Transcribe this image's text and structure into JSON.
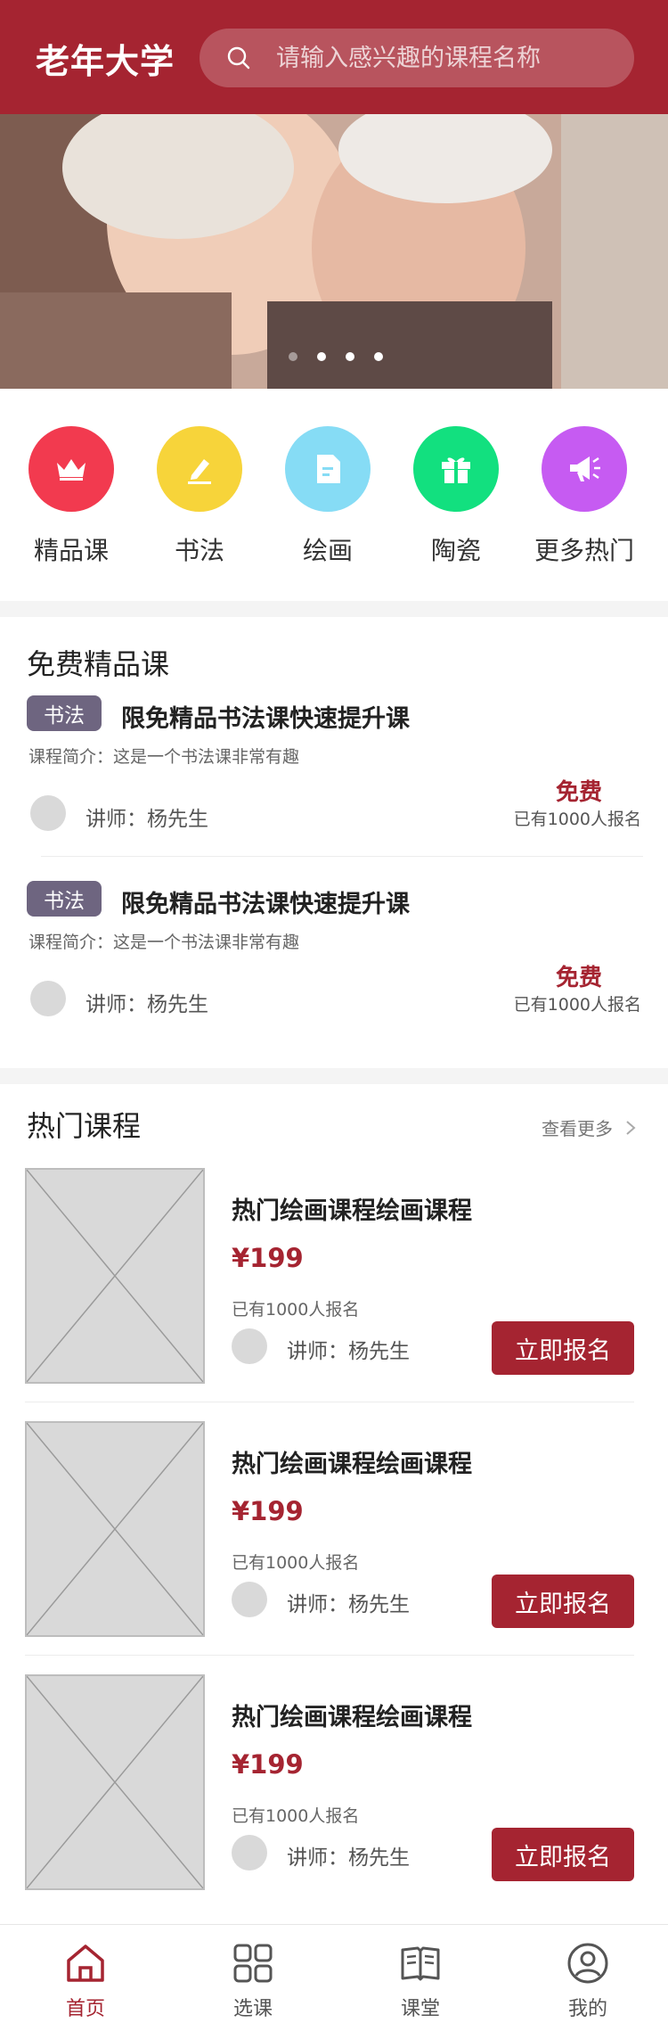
{
  "header": {
    "logo": "老年大学",
    "search_placeholder": "请输入感兴趣的课程名称"
  },
  "banner": {
    "dots": 4,
    "active_dot": 1
  },
  "categories": [
    {
      "label": "精品课",
      "icon": "crown-icon",
      "color": "#f23a4f"
    },
    {
      "label": "书法",
      "icon": "pen-icon",
      "color": "#f7d43a"
    },
    {
      "label": "绘画",
      "icon": "document-icon",
      "color": "#86dcf5"
    },
    {
      "label": "陶瓷",
      "icon": "gift-icon",
      "color": "#12e07f"
    },
    {
      "label": "更多热门",
      "icon": "megaphone-icon",
      "color": "#c65bf2"
    }
  ],
  "free_section": {
    "title": "免费精品课",
    "items": [
      {
        "tag": "书法",
        "title": "限免精品书法课快速提升课",
        "desc": "课程简介：这是一个书法课非常有趣",
        "teacher": "讲师：杨先生",
        "price": "免费",
        "enrolled": "已有1000人报名"
      },
      {
        "tag": "书法",
        "title": "限免精品书法课快速提升课",
        "desc": "课程简介：这是一个书法课非常有趣",
        "teacher": "讲师：杨先生",
        "price": "免费",
        "enrolled": "已有1000人报名"
      }
    ]
  },
  "hot_section": {
    "title": "热门课程",
    "more": "查看更多",
    "items": [
      {
        "title": "热门绘画课程绘画课程",
        "price": "¥199",
        "enrolled": "已有1000人报名",
        "teacher": "讲师：杨先生",
        "button": "立即报名"
      },
      {
        "title": "热门绘画课程绘画课程",
        "price": "¥199",
        "enrolled": "已有1000人报名",
        "teacher": "讲师：杨先生",
        "button": "立即报名"
      },
      {
        "title": "热门绘画课程绘画课程",
        "price": "¥199",
        "enrolled": "已有1000人报名",
        "teacher": "讲师：杨先生",
        "button": "立即报名"
      }
    ]
  },
  "tabbar": {
    "tabs": [
      {
        "label": "首页",
        "icon": "home-icon",
        "active": true
      },
      {
        "label": "选课",
        "icon": "grid-icon",
        "active": false
      },
      {
        "label": "课堂",
        "icon": "book-icon",
        "active": false
      },
      {
        "label": "我的",
        "icon": "user-icon",
        "active": false
      }
    ]
  },
  "colors": {
    "brand": "#a52431",
    "tag": "#6e6580",
    "placeholder": "#d9d9d9"
  }
}
